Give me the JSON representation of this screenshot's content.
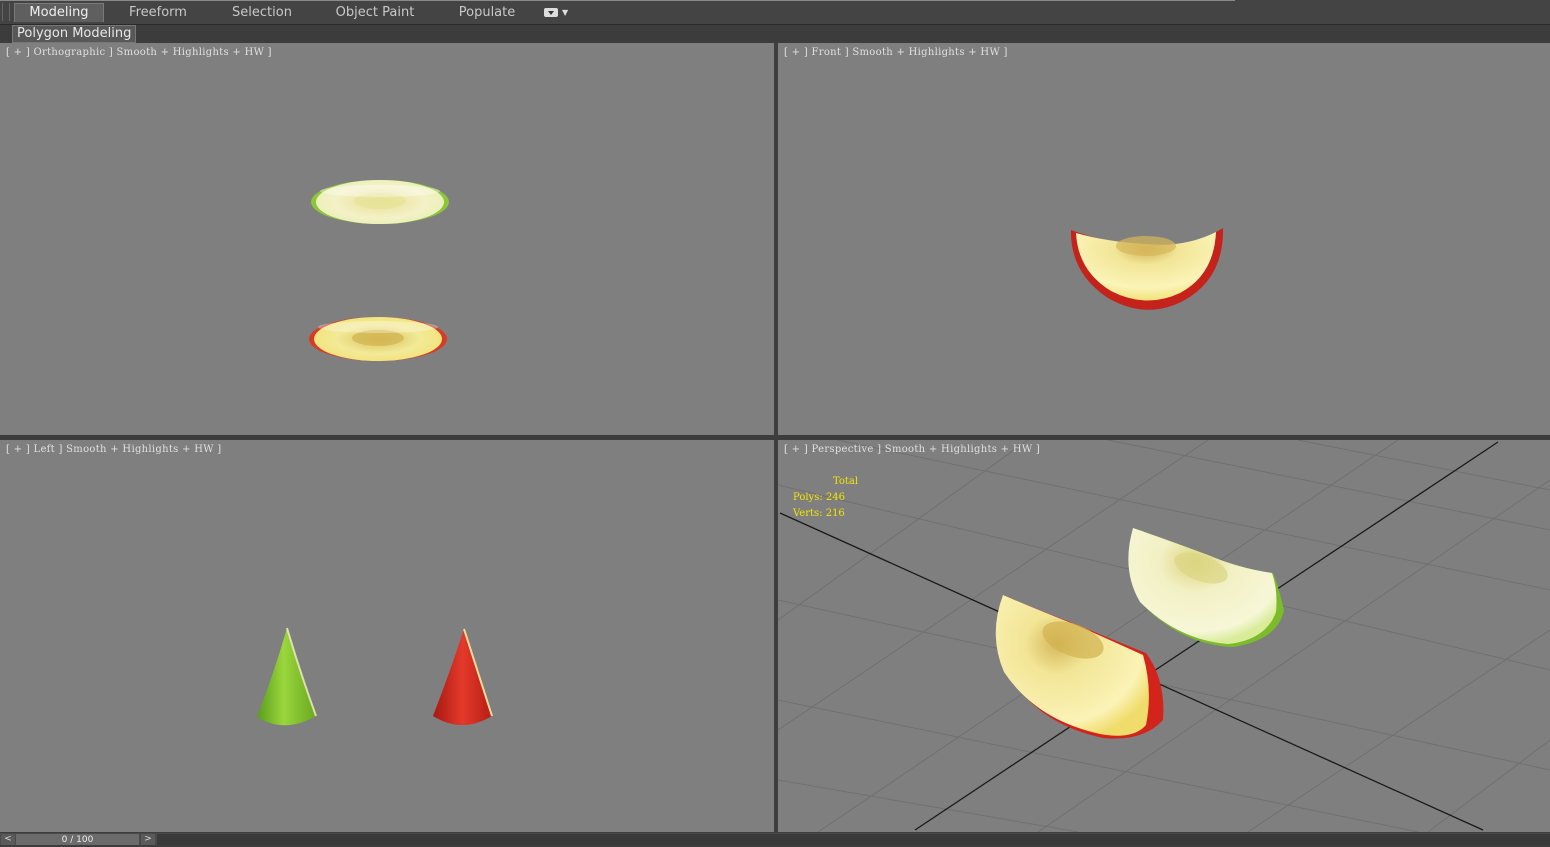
{
  "ribbon": {
    "tabs": [
      {
        "label": "Modeling",
        "active": true
      },
      {
        "label": "Freeform",
        "active": false
      },
      {
        "label": "Selection",
        "active": false
      },
      {
        "label": "Object Paint",
        "active": false
      },
      {
        "label": "Populate",
        "active": false
      }
    ],
    "panel_label": "Polygon Modeling"
  },
  "viewports": {
    "top_left": {
      "label": "[ + ] Orthographic ] Smooth + Highlights + HW ]"
    },
    "top_right": {
      "label": "[ + ] Front ] Smooth + Highlights + HW ]"
    },
    "bottom_left": {
      "label": "[ + ] Left ] Smooth + Highlights + HW ]"
    },
    "bottom_right": {
      "label": "[ + ] Perspective ] Smooth + Highlights + HW ]"
    }
  },
  "stats": {
    "title": "Total",
    "polys": "Polys: 246",
    "verts": "Verts: 216"
  },
  "timeslider": {
    "frame": "0 / 100",
    "prev": "<",
    "next": ">"
  },
  "colors": {
    "viewport_bg": "#7f7f7f",
    "apple_flesh": "#f3eca0",
    "apple_red": "#d5231c",
    "apple_green": "#7cc12a",
    "stats_text": "#f2e500"
  }
}
